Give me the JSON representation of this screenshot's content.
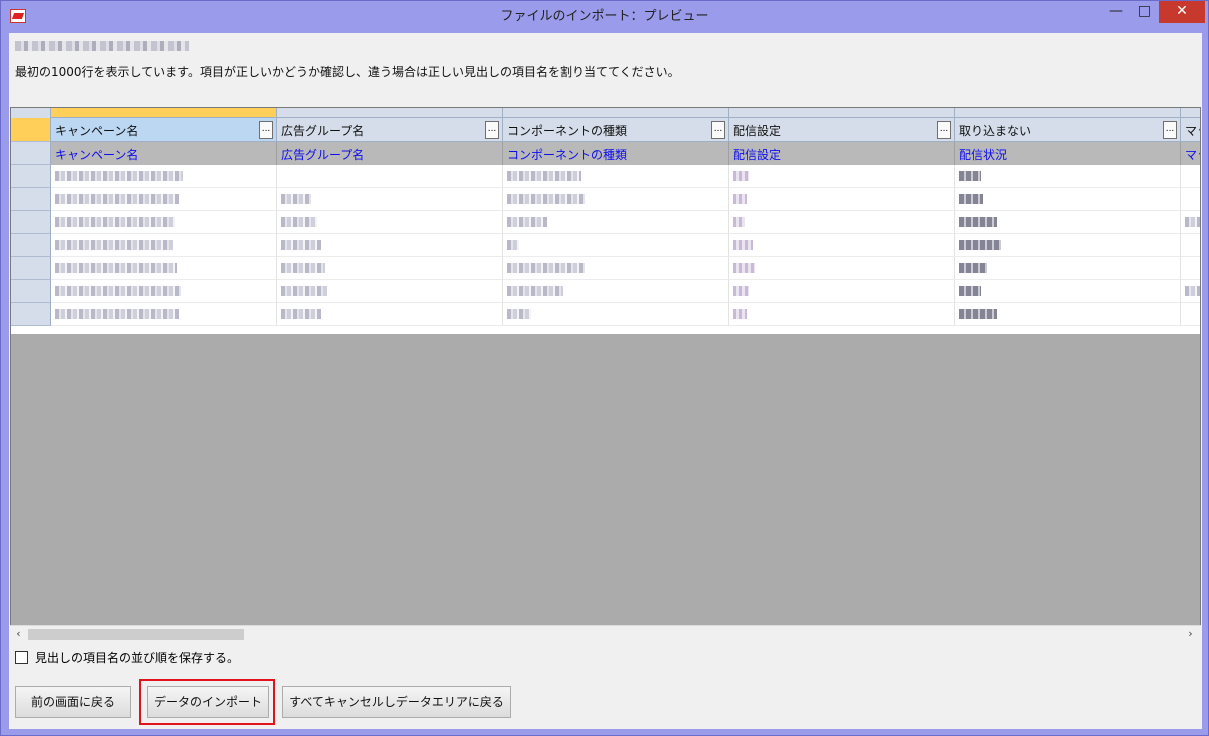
{
  "window": {
    "title": "ファイルのインポート：プレビュー",
    "min_label": "—",
    "max_label": "□",
    "close_label": "✕"
  },
  "info": {
    "text": "最初の1000行を表示しています。項目が正しいかどうか確認し、違う場合は正しい見出しの項目名を割り当ててください。"
  },
  "grid": {
    "ellipsis_label": "...",
    "columns": [
      {
        "header": "キャンペーン名",
        "mapped": "キャンペーン名"
      },
      {
        "header": "広告グループ名",
        "mapped": "広告グループ名"
      },
      {
        "header": "コンポーネントの種類",
        "mapped": "コンポーネントの種類"
      },
      {
        "header": "配信設定",
        "mapped": "配信設定"
      },
      {
        "header": "取り込まない",
        "mapped": "配信状況"
      },
      {
        "header": "マッ",
        "mapped": "マッ"
      }
    ]
  },
  "scroll": {
    "left_arrow": "‹",
    "right_arrow": "›"
  },
  "options": {
    "save_order_label": "見出しの項目名の並び順を保存する。",
    "save_order_checked": false
  },
  "buttons": {
    "back": "前の画面に戻る",
    "import": "データのインポート",
    "cancel_all": "すべてキャンセルしデータエリアに戻る"
  },
  "colors": {
    "highlight": "#e0141a",
    "mapped_text": "#0d0df0",
    "selected_header": "#bcd7f2"
  }
}
